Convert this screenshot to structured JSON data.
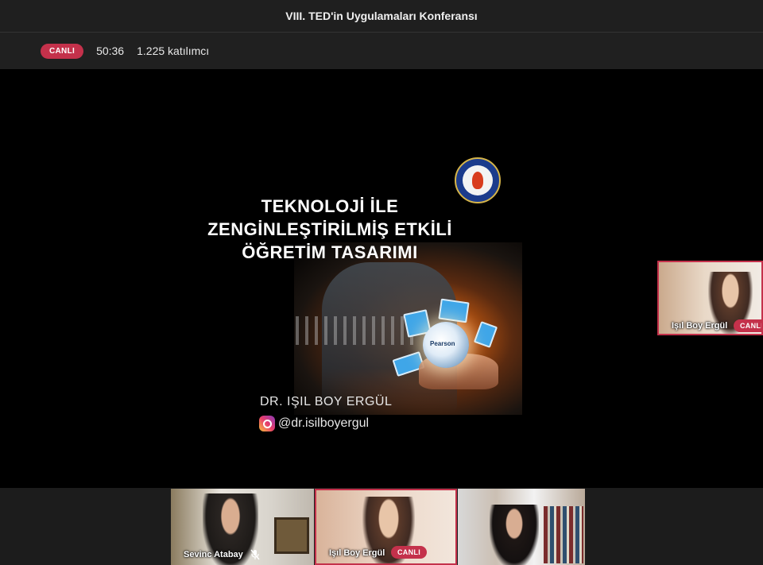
{
  "window": {
    "title": "VIII. TED'in Uygulamaları Konferansı"
  },
  "status": {
    "live_label": "CANLI",
    "elapsed": "50:36",
    "attendees": "1.225 katılımcı"
  },
  "slide": {
    "title_line1": "TEKNOLOJİ İLE",
    "title_line2": "ZENGİNLEŞTİRİLMİŞ ETKİLİ",
    "title_line3": "ÖĞRETİM TASARIMI",
    "brand": "Pearson",
    "presenter": "DR. IŞIL BOY ERGÜL",
    "instagram_handle": "@dr.isilboyergul"
  },
  "participants": {
    "spotlight": {
      "name": "Işıl Boy Ergül",
      "badge": "CANLI"
    },
    "tiles": [
      {
        "name": "Sevinc Atabay",
        "muted": true
      },
      {
        "name": "Işıl Boy Ergül",
        "badge": "CANLI"
      },
      {
        "name": ""
      }
    ]
  },
  "colors": {
    "live": "#c4314b",
    "background": "#000000",
    "bar": "#202020"
  }
}
